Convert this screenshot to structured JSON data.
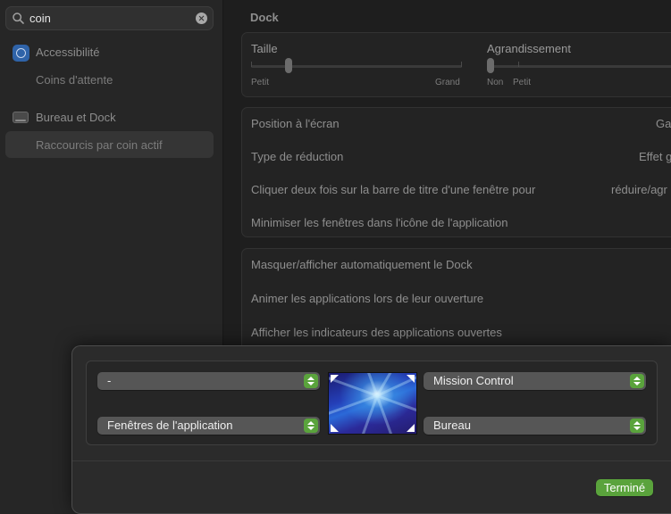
{
  "search": {
    "value": "coin"
  },
  "sidebar": {
    "items": [
      {
        "label": "Accessibilité",
        "sub": "Coins d'attente"
      },
      {
        "label": "Bureau et Dock",
        "sub": "Raccourcis par coin actif"
      }
    ]
  },
  "main": {
    "section_title": "Dock",
    "size": {
      "label": "Taille",
      "min": "Petit",
      "max": "Grand",
      "level": 0.18
    },
    "magnification": {
      "label": "Agrandissement",
      "off": "Non",
      "min": "Petit",
      "level": 0.0
    },
    "position_rows": [
      {
        "label": "Position à l'écran",
        "value": "Ga"
      },
      {
        "label": "Type de réduction",
        "value": "Effet g"
      },
      {
        "label": "Cliquer deux fois sur la barre de titre d'une fenêtre pour",
        "value": "réduire/agr"
      },
      {
        "label": "Minimiser les fenêtres dans l'icône de l'application",
        "value": ""
      }
    ],
    "animation_rows": [
      {
        "label": "Masquer/afficher automatiquement le Dock"
      },
      {
        "label": "Animer les applications lors de leur ouverture"
      },
      {
        "label": "Afficher les indicateurs des applications ouvertes"
      }
    ]
  },
  "dialog": {
    "top_left": "-",
    "top_right": "Mission Control",
    "bottom_left": "Fenêtres de l'application",
    "bottom_right": "Bureau",
    "done_label": "Terminé"
  },
  "colors": {
    "accent": "#5aa33c"
  }
}
